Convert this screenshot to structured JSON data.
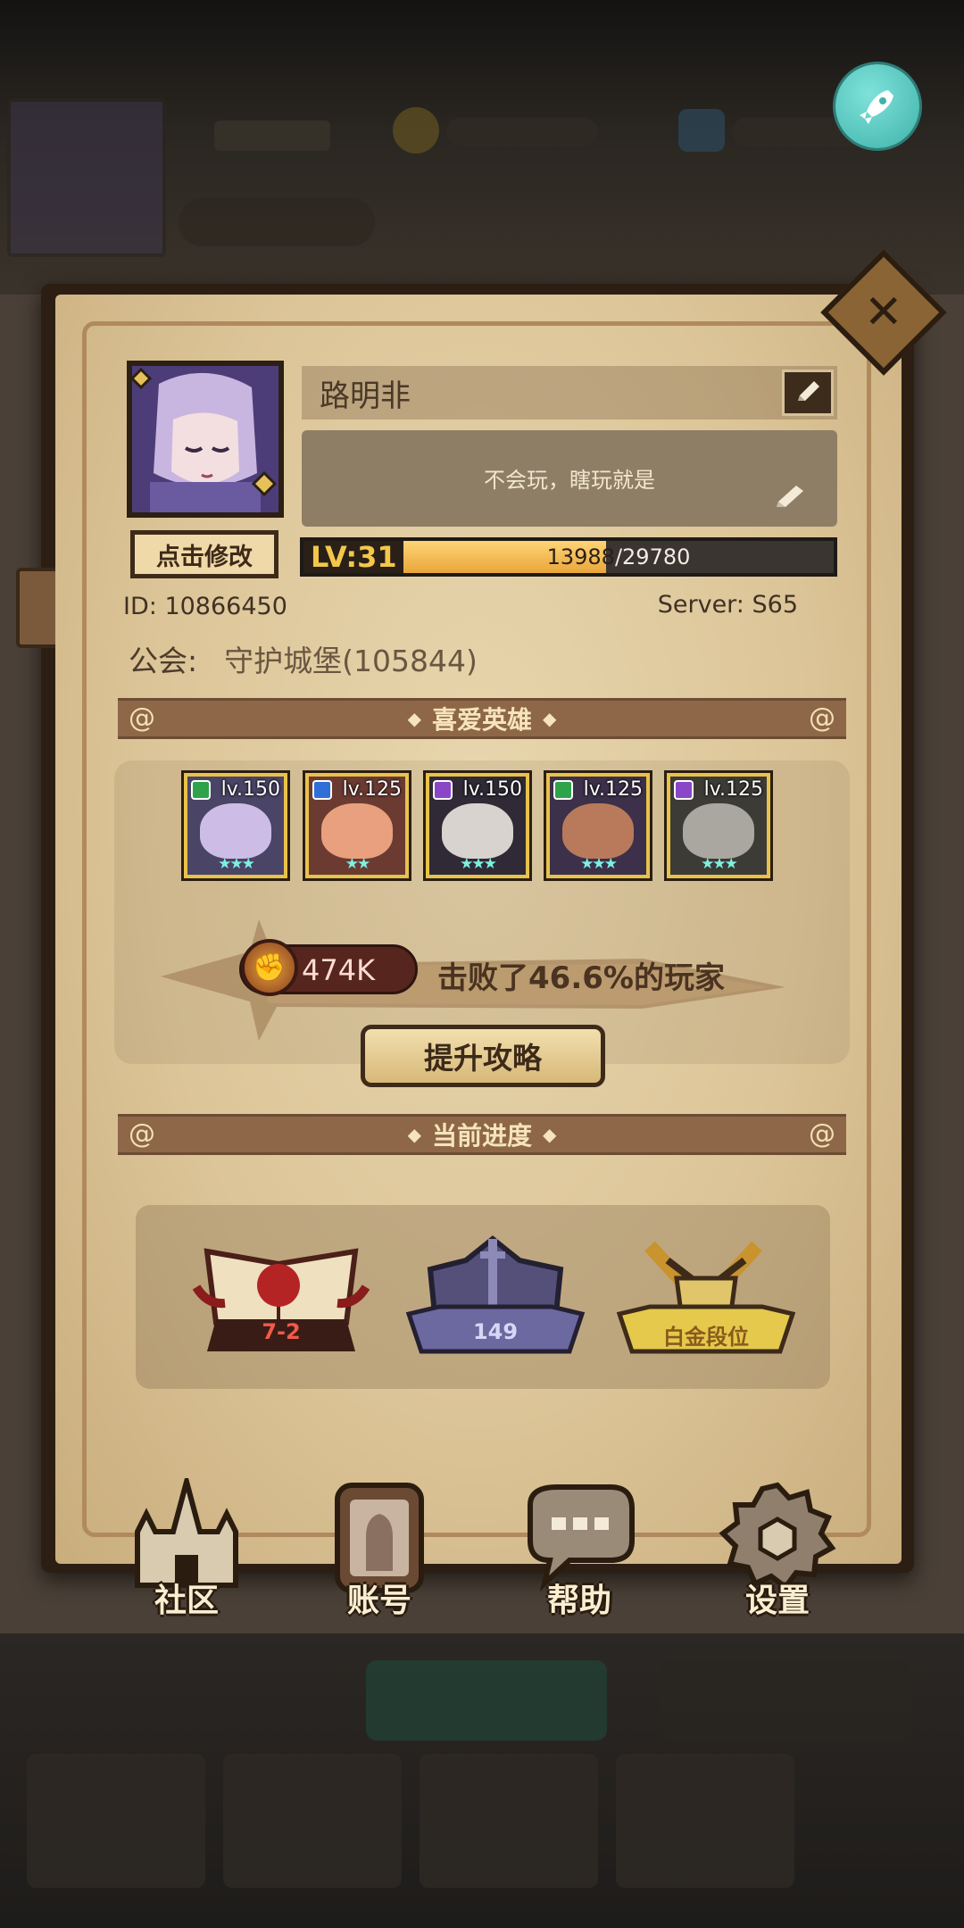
{
  "profile": {
    "name": "路明非",
    "signature": "不会玩，瞎玩就是",
    "modify_label": "点击修改",
    "level_label": "LV:31",
    "exp_current": "13988",
    "exp_max": "/29780",
    "exp_fraction": 0.47,
    "id_label": "ID:",
    "id_value": "10866450",
    "server_label": "Server:",
    "server_value": "S65",
    "guild_label": "公会:",
    "guild_value": "守护城堡(105844)"
  },
  "favorite_heroes": {
    "title": "喜爱英雄",
    "heroes": [
      {
        "level": "lv.150",
        "element_color": "#2fa34a",
        "frame_bg": "#4a4466",
        "face": "#cdbde6"
      },
      {
        "level": "lv.125",
        "element_color": "#2f6fd6",
        "frame_bg": "#6b3b32",
        "face": "#e8a07e"
      },
      {
        "level": "lv.150",
        "element_color": "#8a46c7",
        "frame_bg": "#2f2a36",
        "face": "#d9d3cf"
      },
      {
        "level": "lv.125",
        "element_color": "#2fa34a",
        "frame_bg": "#3d304a",
        "face": "#b87a5b"
      },
      {
        "level": "lv.125",
        "element_color": "#8a46c7",
        "frame_bg": "#3d3b36",
        "face": "#a9a7a0"
      }
    ],
    "power_value": "474K",
    "defeat_text": "击败了46.6%的玩家",
    "strategy_label": "提升攻略"
  },
  "progress": {
    "title": "当前进度",
    "stage": "7-2",
    "tower": "149",
    "rank": "白金段位"
  },
  "nav": {
    "community": "社区",
    "account": "账号",
    "help": "帮助",
    "settings": "设置"
  },
  "colors": {
    "parchment": "#dcc598",
    "banner": "#8d6748",
    "exp_fill": "#e9a63a",
    "rocket": "#4fc3b9"
  }
}
